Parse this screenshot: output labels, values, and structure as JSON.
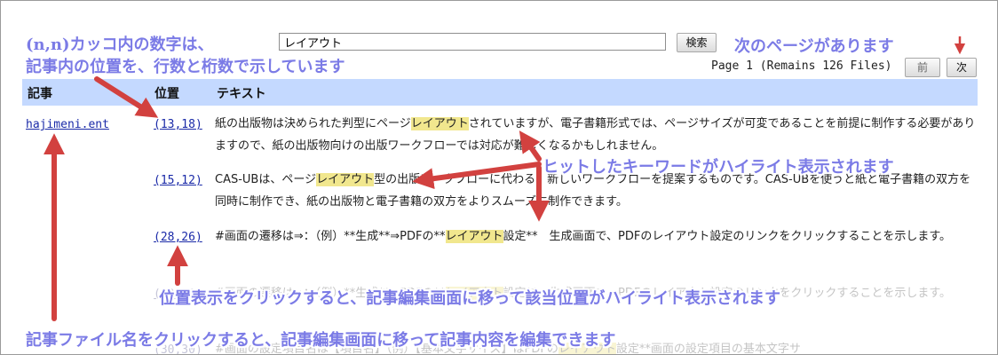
{
  "search": {
    "value": "レイアウト",
    "button_label": "検索"
  },
  "pagination": {
    "info": "Page 1 (Remains 126 Files)",
    "prev_label": "前",
    "next_label": "次"
  },
  "table": {
    "headers": [
      "記事",
      "位置",
      "テキスト"
    ],
    "article": "hajimeni.ent",
    "rows": [
      {
        "pos": "(13,18)",
        "before": "紙の出版物は決められた判型にページ",
        "hit": "レイアウト",
        "after": "されていますが、電子書籍形式では、ページサイズが可変であることを前提に制作する必要がありますので、紙の出版物向けの出版ワークフローでは対応が難しくなるかもしれません。"
      },
      {
        "pos": "(15,12)",
        "before": "CAS-UBは、ページ",
        "hit": "レイアウト",
        "after": "型の出版ワークフローに代わる、新しいワークフローを提案するものです。CAS-UBを使うと紙と電子書籍の双方を同時に制作でき、紙の出版物と電子書籍の双方をよりスムーズに制作できます。"
      },
      {
        "pos": "(28,26)",
        "before": "#画面の遷移は⇒：（例）**生成**⇒PDFの**",
        "hit": "レイアウト",
        "after": "設定**　生成画面で、PDFのレイアウト設定のリンクをクリックすることを示します。"
      }
    ],
    "faded_rows": [
      {
        "pos": "(29,10)",
        "before": "#画面の遷移は⇒：（例）**生成**⇒PDFの**",
        "hit": "レイアウト",
        "after": "設定**　生成画面で、PDFのレイアウト設定のリンクをクリックすることを示します。"
      },
      {
        "pos": "(30,30)",
        "before": "#画面の設定項目名は【項目名】（例）【基本文字サイズ】はPDFの",
        "hit": "レイアウト",
        "after": "設定**画面の設定項目の基本文字サ"
      }
    ]
  },
  "annotations": {
    "position_note_line1": "(n,n)カッコ内の数字は、",
    "position_note_line2": "記事内の位置を、行数と桁数で示しています",
    "next_page_note": "次のページがあります",
    "highlight_note": "ヒットしたキーワードがハイライト表示されます",
    "click_position_note": "位置表示をクリックすると、記事編集画面に移って該当位置がハイライト表示されます",
    "click_article_note": "記事ファイル名をクリックすると、記事編集画面に移って記事内容を編集できます"
  },
  "colors": {
    "arrow": "#d2413f",
    "annotation": "#7b7be6",
    "highlight": "#f1e78e",
    "header_bg": "#c4d9ff"
  }
}
